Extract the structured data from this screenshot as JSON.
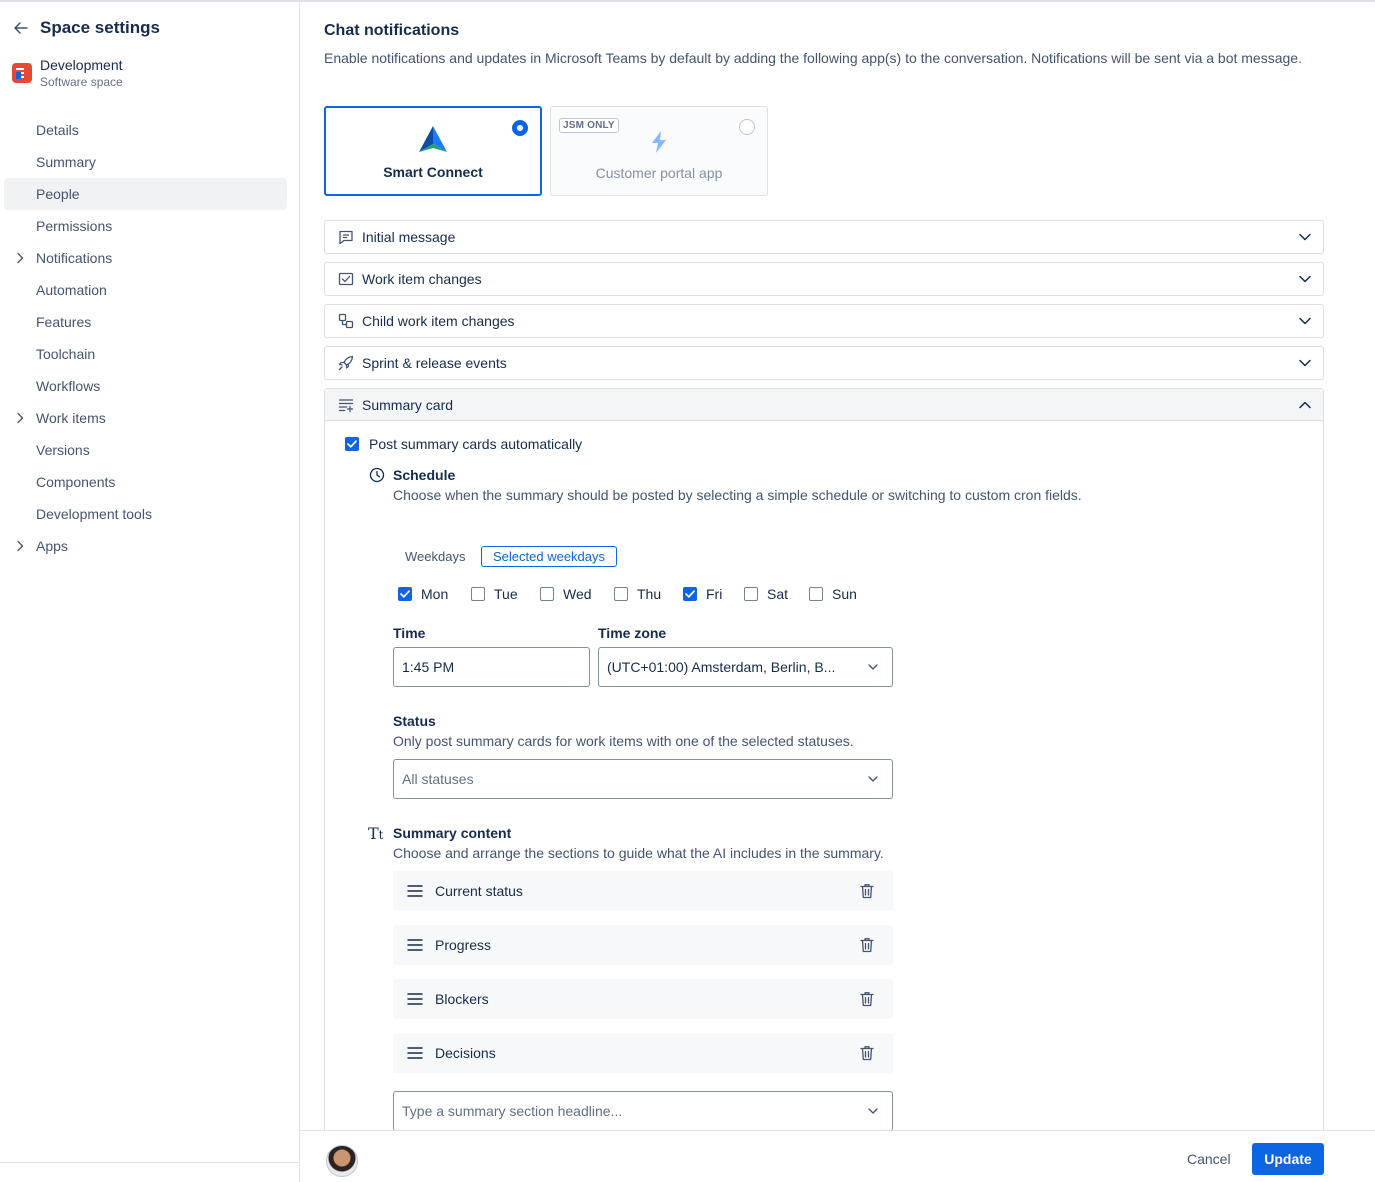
{
  "sidebar": {
    "title": "Space settings",
    "space": {
      "name": "Development",
      "type": "Software space"
    },
    "items": [
      {
        "label": "Details",
        "expandable": false,
        "active": false
      },
      {
        "label": "Summary",
        "expandable": false,
        "active": false
      },
      {
        "label": "People",
        "expandable": false,
        "active": true
      },
      {
        "label": "Permissions",
        "expandable": false,
        "active": false
      },
      {
        "label": "Notifications",
        "expandable": true,
        "active": false
      },
      {
        "label": "Automation",
        "expandable": false,
        "active": false
      },
      {
        "label": "Features",
        "expandable": false,
        "active": false
      },
      {
        "label": "Toolchain",
        "expandable": false,
        "active": false
      },
      {
        "label": "Workflows",
        "expandable": false,
        "active": false
      },
      {
        "label": "Work items",
        "expandable": true,
        "active": false
      },
      {
        "label": "Versions",
        "expandable": false,
        "active": false
      },
      {
        "label": "Components",
        "expandable": false,
        "active": false
      },
      {
        "label": "Development tools",
        "expandable": false,
        "active": false
      },
      {
        "label": "Apps",
        "expandable": true,
        "active": false
      }
    ]
  },
  "main": {
    "title": "Chat notifications",
    "description": "Enable notifications and updates in Microsoft Teams by default by adding the following app(s) to the conversation. Notifications will be sent via a bot message.",
    "apps": [
      {
        "label": "Smart Connect",
        "selected": true,
        "badge": ""
      },
      {
        "label": "Customer portal app",
        "selected": false,
        "badge": "JSM ONLY"
      }
    ],
    "accordions": [
      {
        "label": "Initial message",
        "icon": "message-icon"
      },
      {
        "label": "Work item changes",
        "icon": "checkbox-icon"
      },
      {
        "label": "Child work item changes",
        "icon": "subtask-icon"
      },
      {
        "label": "Sprint & release events",
        "icon": "rocket-icon"
      }
    ],
    "summary_card": {
      "label": "Summary card",
      "post_automatically": {
        "label": "Post summary cards automatically",
        "checked": true
      },
      "schedule": {
        "title": "Schedule",
        "description": "Choose when the summary should be posted by selecting a simple schedule or switching to custom cron fields.",
        "modes": [
          "Weekdays",
          "Selected weekdays"
        ],
        "selected_mode": "Selected weekdays",
        "days": [
          {
            "label": "Mon",
            "checked": true
          },
          {
            "label": "Tue",
            "checked": false
          },
          {
            "label": "Wed",
            "checked": false
          },
          {
            "label": "Thu",
            "checked": false
          },
          {
            "label": "Fri",
            "checked": true
          },
          {
            "label": "Sat",
            "checked": false
          },
          {
            "label": "Sun",
            "checked": false
          }
        ],
        "time_label": "Time",
        "time_value": "1:45 PM",
        "timezone_label": "Time zone",
        "timezone_value": "(UTC+01:00) Amsterdam, Berlin, B..."
      },
      "status": {
        "title": "Status",
        "description": "Only post summary cards for work items with one of the selected statuses.",
        "placeholder": "All statuses"
      },
      "content": {
        "title": "Summary content",
        "description": "Choose and arrange the sections to guide what the AI includes in the summary.",
        "sections": [
          "Current status",
          "Progress",
          "Blockers",
          "Decisions"
        ],
        "add_placeholder": "Type a summary section headline..."
      }
    }
  },
  "footer": {
    "cancel": "Cancel",
    "update": "Update"
  },
  "colors": {
    "accent": "#0c66e4",
    "border": "#dcdfe4",
    "text": "#172b4d",
    "subtle": "#44546f"
  }
}
